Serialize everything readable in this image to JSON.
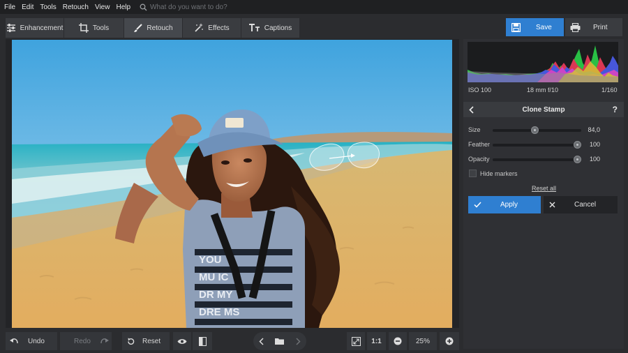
{
  "menu": [
    "File",
    "Edit",
    "Tools",
    "Retouch",
    "View",
    "Help"
  ],
  "search": {
    "placeholder": "What do you want to do?"
  },
  "tabs": [
    {
      "label": "Enhancement",
      "icon": "sliders-icon"
    },
    {
      "label": "Tools",
      "icon": "crop-icon"
    },
    {
      "label": "Retouch",
      "icon": "brush-icon",
      "active": true
    },
    {
      "label": "Effects",
      "icon": "magic-wand-icon"
    },
    {
      "label": "Captions",
      "icon": "text-icon"
    }
  ],
  "actions": {
    "save": "Save",
    "print": "Print"
  },
  "exif": {
    "iso": "ISO 100",
    "lens": "18 mm f/10",
    "shutter": "1/160"
  },
  "clone_stamp": {
    "title": "Clone Stamp",
    "help": "?",
    "size": {
      "label": "Size",
      "value": "84,0",
      "fraction": 0.47
    },
    "feather": {
      "label": "Feather",
      "value": "100",
      "fraction": 1.0
    },
    "opacity": {
      "label": "Opacity",
      "value": "100",
      "fraction": 1.0
    },
    "hide_markers": "Hide markers",
    "reset_all": "Reset all",
    "apply": "Apply",
    "cancel": "Cancel"
  },
  "bottom": {
    "undo": "Undo",
    "redo": "Redo",
    "reset": "Reset",
    "one_to_one": "1:1",
    "zoom": "25%"
  },
  "colors": {
    "accent": "#2f7fd1",
    "panel": "#2f3034",
    "background": "#2b2c2f"
  }
}
